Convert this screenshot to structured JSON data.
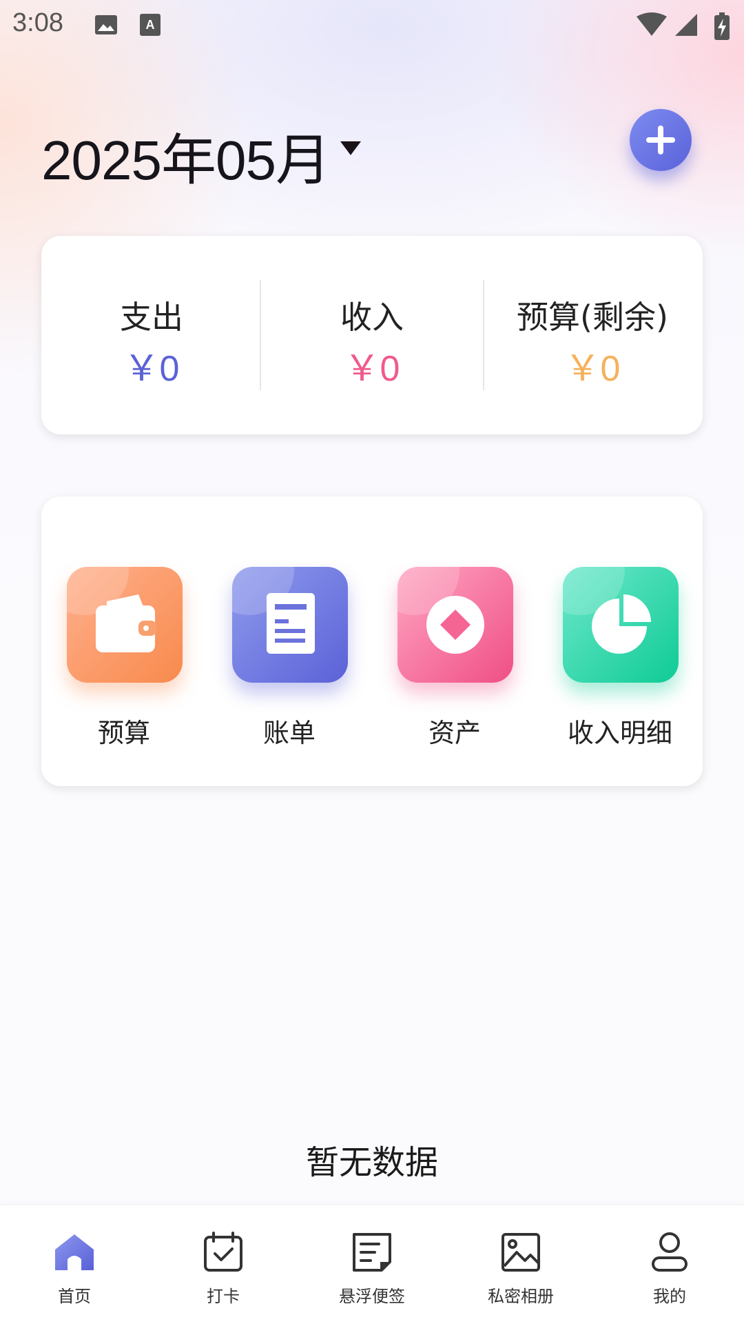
{
  "status_bar": {
    "time": "3:08"
  },
  "header": {
    "month": "2025年05月"
  },
  "summary": {
    "expense": {
      "label": "支出",
      "value": "￥0",
      "color": "#5a62d6"
    },
    "income": {
      "label": "收入",
      "value": "￥0",
      "color": "#ef5a8c"
    },
    "budget": {
      "label": "预算(剩余)",
      "value": "￥0",
      "color": "#f6b15c"
    }
  },
  "shortcuts": [
    {
      "label": "预算",
      "icon": "wallet-icon",
      "colors": [
        "#ffb08e",
        "#f88a4d"
      ]
    },
    {
      "label": "账单",
      "icon": "document-icon",
      "colors": [
        "#8f9bec",
        "#5b62d8"
      ]
    },
    {
      "label": "资产",
      "icon": "coin-icon",
      "colors": [
        "#ffa6c2",
        "#ef4f86"
      ]
    },
    {
      "label": "收入明细",
      "icon": "pie-chart-icon",
      "colors": [
        "#6ee8cb",
        "#0fcb95"
      ]
    }
  ],
  "empty_state": "暂无数据",
  "bottom_nav": [
    {
      "label": "首页",
      "icon": "home-icon",
      "active": true
    },
    {
      "label": "打卡",
      "icon": "calendar-check-icon",
      "active": false
    },
    {
      "label": "悬浮便签",
      "icon": "note-icon",
      "active": false
    },
    {
      "label": "私密相册",
      "icon": "image-icon",
      "active": false
    },
    {
      "label": "我的",
      "icon": "person-icon",
      "active": false
    }
  ],
  "colors": {
    "accent": "#6068dc"
  }
}
